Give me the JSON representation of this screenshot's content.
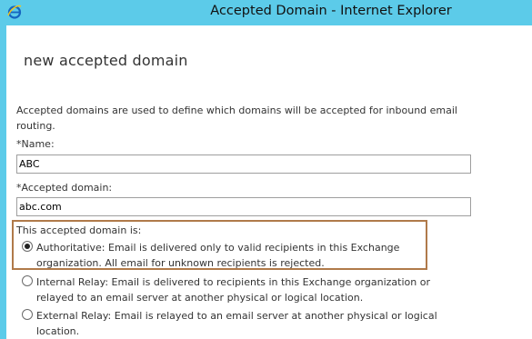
{
  "window": {
    "title": "Accepted Domain - Internet Explorer"
  },
  "dialog": {
    "title": "new accepted domain",
    "description": "Accepted domains are used to define which domains will be accepted for inbound email routing.",
    "name_label": "*Name:",
    "name_value": "ABC",
    "domain_label": "*Accepted domain:",
    "domain_value": "abc.com",
    "type_label": "This accepted domain is:",
    "options": [
      {
        "text": "Authoritative: Email is delivered only to valid recipients in this Exchange organization. All email for unknown recipients is rejected.",
        "selected": true
      },
      {
        "text": "Internal Relay: Email is delivered to recipients in this Exchange organization or relayed to an email server at another physical or logical location.",
        "selected": false
      },
      {
        "text": "External Relay: Email is relayed to an email server at another physical or logical location.",
        "selected": false
      }
    ]
  },
  "colors": {
    "titlebar": "#5ccbe9",
    "highlight_border": "#b07a4a"
  },
  "icons": {
    "browser": "internet-explorer-icon"
  }
}
